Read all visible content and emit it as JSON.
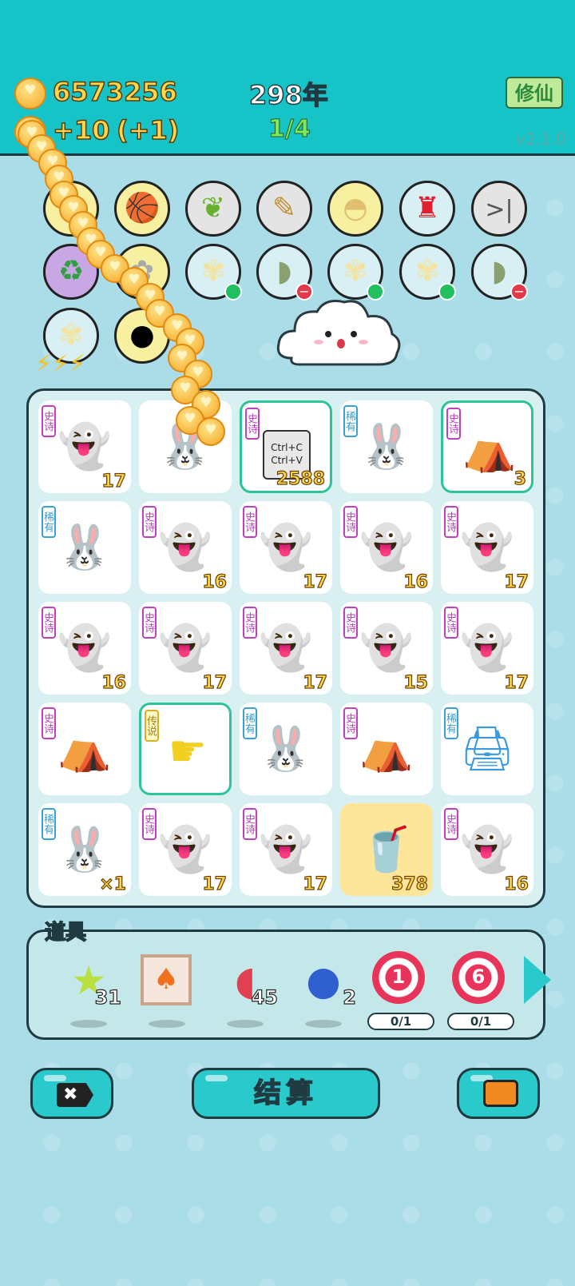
{
  "header": {
    "coins": "6573256",
    "income": "+10",
    "income_bonus": "(+1)",
    "year": "298年",
    "progress": "1/4",
    "cultivate_button": "修仙",
    "version": "v2.1.0"
  },
  "board": {
    "cells": [
      {
        "tag": "史诗",
        "tag_color": "purple",
        "icon": "ghost-icon",
        "count": "17"
      },
      {
        "tag": "",
        "tag_color": "blue",
        "icon": "rabbit-icon",
        "count": ""
      },
      {
        "tag": "史诗",
        "tag_color": "purple",
        "icon": "copy-paste-icon",
        "count": "2588",
        "copy1": "Ctrl+C",
        "copy2": "Ctrl+V",
        "selected": true
      },
      {
        "tag": "稀有",
        "tag_color": "blue",
        "icon": "rabbit-icon",
        "count": ""
      },
      {
        "tag": "史诗",
        "tag_color": "purple",
        "icon": "lantern-house-icon",
        "count": "3",
        "selected": true
      },
      {
        "tag": "稀有",
        "tag_color": "blue",
        "icon": "rabbit-icon",
        "count": ""
      },
      {
        "tag": "史诗",
        "tag_color": "purple",
        "icon": "ghost-icon",
        "count": "16"
      },
      {
        "tag": "史诗",
        "tag_color": "purple",
        "icon": "ghost-icon",
        "count": "17"
      },
      {
        "tag": "史诗",
        "tag_color": "purple",
        "icon": "ghost-icon",
        "count": "16"
      },
      {
        "tag": "史诗",
        "tag_color": "purple",
        "icon": "ghost-icon",
        "count": "17"
      },
      {
        "tag": "史诗",
        "tag_color": "purple",
        "icon": "ghost-icon",
        "count": "16"
      },
      {
        "tag": "史诗",
        "tag_color": "purple",
        "icon": "ghost-icon",
        "count": "17"
      },
      {
        "tag": "史诗",
        "tag_color": "purple",
        "icon": "ghost-icon",
        "count": "17"
      },
      {
        "tag": "史诗",
        "tag_color": "purple",
        "icon": "ghost-icon",
        "count": "15"
      },
      {
        "tag": "史诗",
        "tag_color": "purple",
        "icon": "ghost-icon",
        "count": "17"
      },
      {
        "tag": "史诗",
        "tag_color": "purple",
        "icon": "lantern-house-icon",
        "count": ""
      },
      {
        "tag": "传说",
        "tag_color": "yellow",
        "icon": "pointing-hand-icon",
        "count": "",
        "selected": true
      },
      {
        "tag": "稀有",
        "tag_color": "blue",
        "icon": "rabbit-icon",
        "count": ""
      },
      {
        "tag": "史诗",
        "tag_color": "purple",
        "icon": "lantern-house-icon",
        "count": ""
      },
      {
        "tag": "稀有",
        "tag_color": "blue",
        "icon": "printer-icon",
        "count": ""
      },
      {
        "tag": "稀有",
        "tag_color": "blue",
        "icon": "rabbit-icon",
        "count": "×1"
      },
      {
        "tag": "史诗",
        "tag_color": "purple",
        "icon": "ghost-icon",
        "count": "17"
      },
      {
        "tag": "史诗",
        "tag_color": "purple",
        "icon": "ghost-icon",
        "count": "17"
      },
      {
        "tag": "",
        "tag_color": "purple",
        "icon": "cup-icon",
        "count": "378",
        "gold": true
      },
      {
        "tag": "史诗",
        "tag_color": "purple",
        "icon": "ghost-icon",
        "count": "16"
      }
    ]
  },
  "props": {
    "label": "道具",
    "items": [
      {
        "icon": "star-icon",
        "count": "31"
      },
      {
        "icon": "carrot-frame-icon",
        "count": ""
      },
      {
        "icon": "liver-icon",
        "count": "45"
      },
      {
        "icon": "blueberry-icon",
        "count": "2"
      },
      {
        "icon": "target-icon",
        "number": "1",
        "progress": "0/1"
      },
      {
        "icon": "target-icon",
        "number": "6",
        "progress": "0/1"
      }
    ]
  },
  "buttons": {
    "settle": "结算"
  }
}
